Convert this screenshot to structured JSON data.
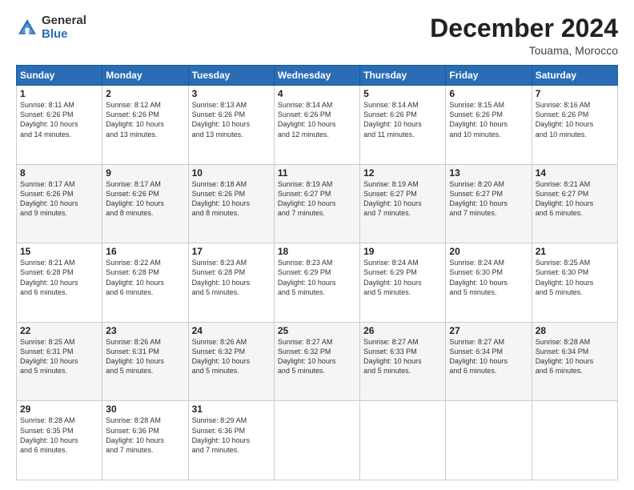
{
  "logo": {
    "general": "General",
    "blue": "Blue"
  },
  "header": {
    "title": "December 2024",
    "location": "Touama, Morocco"
  },
  "weekdays": [
    "Sunday",
    "Monday",
    "Tuesday",
    "Wednesday",
    "Thursday",
    "Friday",
    "Saturday"
  ],
  "weeks": [
    [
      {
        "day": "1",
        "info": "Sunrise: 8:11 AM\nSunset: 6:26 PM\nDaylight: 10 hours\nand 14 minutes."
      },
      {
        "day": "2",
        "info": "Sunrise: 8:12 AM\nSunset: 6:26 PM\nDaylight: 10 hours\nand 13 minutes."
      },
      {
        "day": "3",
        "info": "Sunrise: 8:13 AM\nSunset: 6:26 PM\nDaylight: 10 hours\nand 13 minutes."
      },
      {
        "day": "4",
        "info": "Sunrise: 8:14 AM\nSunset: 6:26 PM\nDaylight: 10 hours\nand 12 minutes."
      },
      {
        "day": "5",
        "info": "Sunrise: 8:14 AM\nSunset: 6:26 PM\nDaylight: 10 hours\nand 11 minutes."
      },
      {
        "day": "6",
        "info": "Sunrise: 8:15 AM\nSunset: 6:26 PM\nDaylight: 10 hours\nand 10 minutes."
      },
      {
        "day": "7",
        "info": "Sunrise: 8:16 AM\nSunset: 6:26 PM\nDaylight: 10 hours\nand 10 minutes."
      }
    ],
    [
      {
        "day": "8",
        "info": "Sunrise: 8:17 AM\nSunset: 6:26 PM\nDaylight: 10 hours\nand 9 minutes."
      },
      {
        "day": "9",
        "info": "Sunrise: 8:17 AM\nSunset: 6:26 PM\nDaylight: 10 hours\nand 8 minutes."
      },
      {
        "day": "10",
        "info": "Sunrise: 8:18 AM\nSunset: 6:26 PM\nDaylight: 10 hours\nand 8 minutes."
      },
      {
        "day": "11",
        "info": "Sunrise: 8:19 AM\nSunset: 6:27 PM\nDaylight: 10 hours\nand 7 minutes."
      },
      {
        "day": "12",
        "info": "Sunrise: 8:19 AM\nSunset: 6:27 PM\nDaylight: 10 hours\nand 7 minutes."
      },
      {
        "day": "13",
        "info": "Sunrise: 8:20 AM\nSunset: 6:27 PM\nDaylight: 10 hours\nand 7 minutes."
      },
      {
        "day": "14",
        "info": "Sunrise: 8:21 AM\nSunset: 6:27 PM\nDaylight: 10 hours\nand 6 minutes."
      }
    ],
    [
      {
        "day": "15",
        "info": "Sunrise: 8:21 AM\nSunset: 6:28 PM\nDaylight: 10 hours\nand 6 minutes."
      },
      {
        "day": "16",
        "info": "Sunrise: 8:22 AM\nSunset: 6:28 PM\nDaylight: 10 hours\nand 6 minutes."
      },
      {
        "day": "17",
        "info": "Sunrise: 8:23 AM\nSunset: 6:28 PM\nDaylight: 10 hours\nand 5 minutes."
      },
      {
        "day": "18",
        "info": "Sunrise: 8:23 AM\nSunset: 6:29 PM\nDaylight: 10 hours\nand 5 minutes."
      },
      {
        "day": "19",
        "info": "Sunrise: 8:24 AM\nSunset: 6:29 PM\nDaylight: 10 hours\nand 5 minutes."
      },
      {
        "day": "20",
        "info": "Sunrise: 8:24 AM\nSunset: 6:30 PM\nDaylight: 10 hours\nand 5 minutes."
      },
      {
        "day": "21",
        "info": "Sunrise: 8:25 AM\nSunset: 6:30 PM\nDaylight: 10 hours\nand 5 minutes."
      }
    ],
    [
      {
        "day": "22",
        "info": "Sunrise: 8:25 AM\nSunset: 6:31 PM\nDaylight: 10 hours\nand 5 minutes."
      },
      {
        "day": "23",
        "info": "Sunrise: 8:26 AM\nSunset: 6:31 PM\nDaylight: 10 hours\nand 5 minutes."
      },
      {
        "day": "24",
        "info": "Sunrise: 8:26 AM\nSunset: 6:32 PM\nDaylight: 10 hours\nand 5 minutes."
      },
      {
        "day": "25",
        "info": "Sunrise: 8:27 AM\nSunset: 6:32 PM\nDaylight: 10 hours\nand 5 minutes."
      },
      {
        "day": "26",
        "info": "Sunrise: 8:27 AM\nSunset: 6:33 PM\nDaylight: 10 hours\nand 5 minutes."
      },
      {
        "day": "27",
        "info": "Sunrise: 8:27 AM\nSunset: 6:34 PM\nDaylight: 10 hours\nand 6 minutes."
      },
      {
        "day": "28",
        "info": "Sunrise: 8:28 AM\nSunset: 6:34 PM\nDaylight: 10 hours\nand 6 minutes."
      }
    ],
    [
      {
        "day": "29",
        "info": "Sunrise: 8:28 AM\nSunset: 6:35 PM\nDaylight: 10 hours\nand 6 minutes."
      },
      {
        "day": "30",
        "info": "Sunrise: 8:28 AM\nSunset: 6:36 PM\nDaylight: 10 hours\nand 7 minutes."
      },
      {
        "day": "31",
        "info": "Sunrise: 8:29 AM\nSunset: 6:36 PM\nDaylight: 10 hours\nand 7 minutes."
      },
      null,
      null,
      null,
      null
    ]
  ]
}
